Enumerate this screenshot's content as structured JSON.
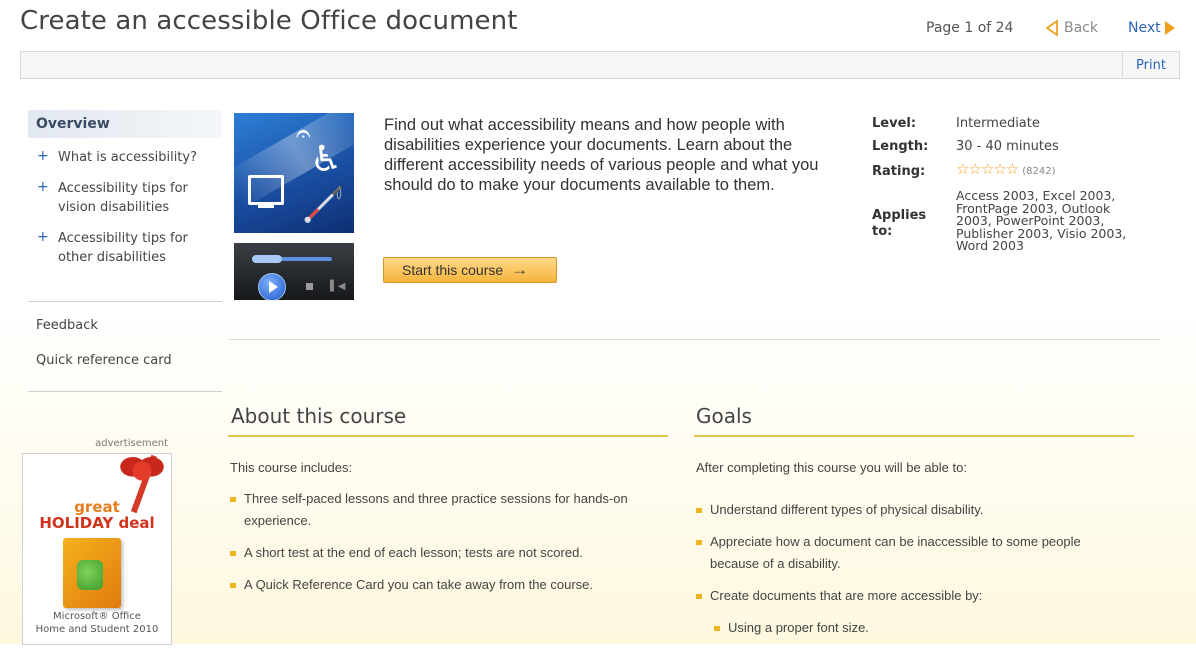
{
  "header": {
    "title": "Create an accessible Office document",
    "page_indicator": "Page 1 of 24",
    "back_label": "Back",
    "next_label": "Next",
    "print_label": "Print"
  },
  "sidebar": {
    "overview": "Overview",
    "items": [
      {
        "label_line1": "What is accessibility?",
        "label_line2": ""
      },
      {
        "label_line1": "Accessibility tips for",
        "label_line2": "vision disabilities"
      },
      {
        "label_line1": "Accessibility tips for",
        "label_line2": "other disabilities"
      }
    ],
    "feedback": "Feedback",
    "quick_reference": "Quick reference card"
  },
  "ad": {
    "label": "advertisement",
    "headline1": "great",
    "headline2": "HOLIDAY deal",
    "caption_line1": "Microsoft® Office",
    "caption_line2": "Home and Student 2010"
  },
  "intro": {
    "text": "Find out what accessibility means and how people with disabilities experience your documents. Learn about the different accessibility needs of various people and what you should do to make your documents available to them.",
    "start_button": "Start this course"
  },
  "meta": {
    "level_label": "Level:",
    "level_value": "Intermediate",
    "length_label": "Length:",
    "length_value": "30 - 40 minutes",
    "rating_label": "Rating:",
    "rating_stars": "☆☆☆☆☆",
    "rating_count": "(8242)",
    "applies_label_line1": "Applies",
    "applies_label_line2": "to:",
    "applies_value": "Access 2003, Excel 2003, FrontPage 2003, Outlook 2003, PowerPoint 2003, Publisher 2003, Visio 2003, Word 2003"
  },
  "about": {
    "title": "About this course",
    "intro": "This course includes:",
    "items": [
      "Three self-paced lessons and three practice sessions for hands-on experience.",
      "A short test at the end of each lesson; tests are not scored.",
      "A Quick Reference Card you can take away from the course."
    ]
  },
  "goals": {
    "title": "Goals",
    "intro": "After completing this course you will be able to:",
    "items": [
      "Understand different types of physical disability.",
      "Appreciate how a document can be inaccessible to some people because of a disability.",
      "Create documents that are more accessible by:"
    ],
    "sub_items": [
      "Using a proper font size."
    ]
  },
  "colors": {
    "accent_orange": "#f0a020",
    "link_blue": "#2a63b8",
    "section_rule": "#e7c44a"
  }
}
